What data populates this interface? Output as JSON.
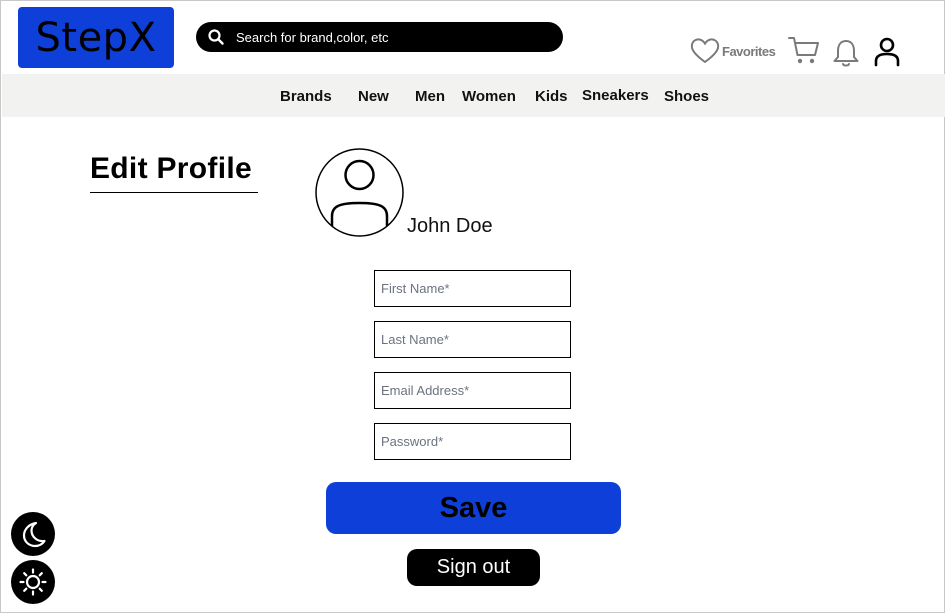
{
  "header": {
    "logo_text": "StepX",
    "search_placeholder": "Search for brand,color, etc",
    "favorites_label": "Favorites"
  },
  "nav": {
    "items": [
      "Brands",
      "New",
      "Men",
      "Women",
      "Kids",
      "Sneakers",
      "Shoes"
    ]
  },
  "profile": {
    "title": "Edit Profile",
    "user_name": "John Doe"
  },
  "form": {
    "first_name_placeholder": "First Name*",
    "last_name_placeholder": "Last Name*",
    "email_placeholder": "Email Address*",
    "password_placeholder": "Password*",
    "save_label": "Save",
    "signout_label": "Sign out"
  },
  "theme": {
    "dark_mode_icon": "moon-icon",
    "light_mode_icon": "sun-icon"
  },
  "colors": {
    "brand_blue": "#0f3fd9",
    "nav_background": "#f2f2f0",
    "dark": "#000000"
  }
}
